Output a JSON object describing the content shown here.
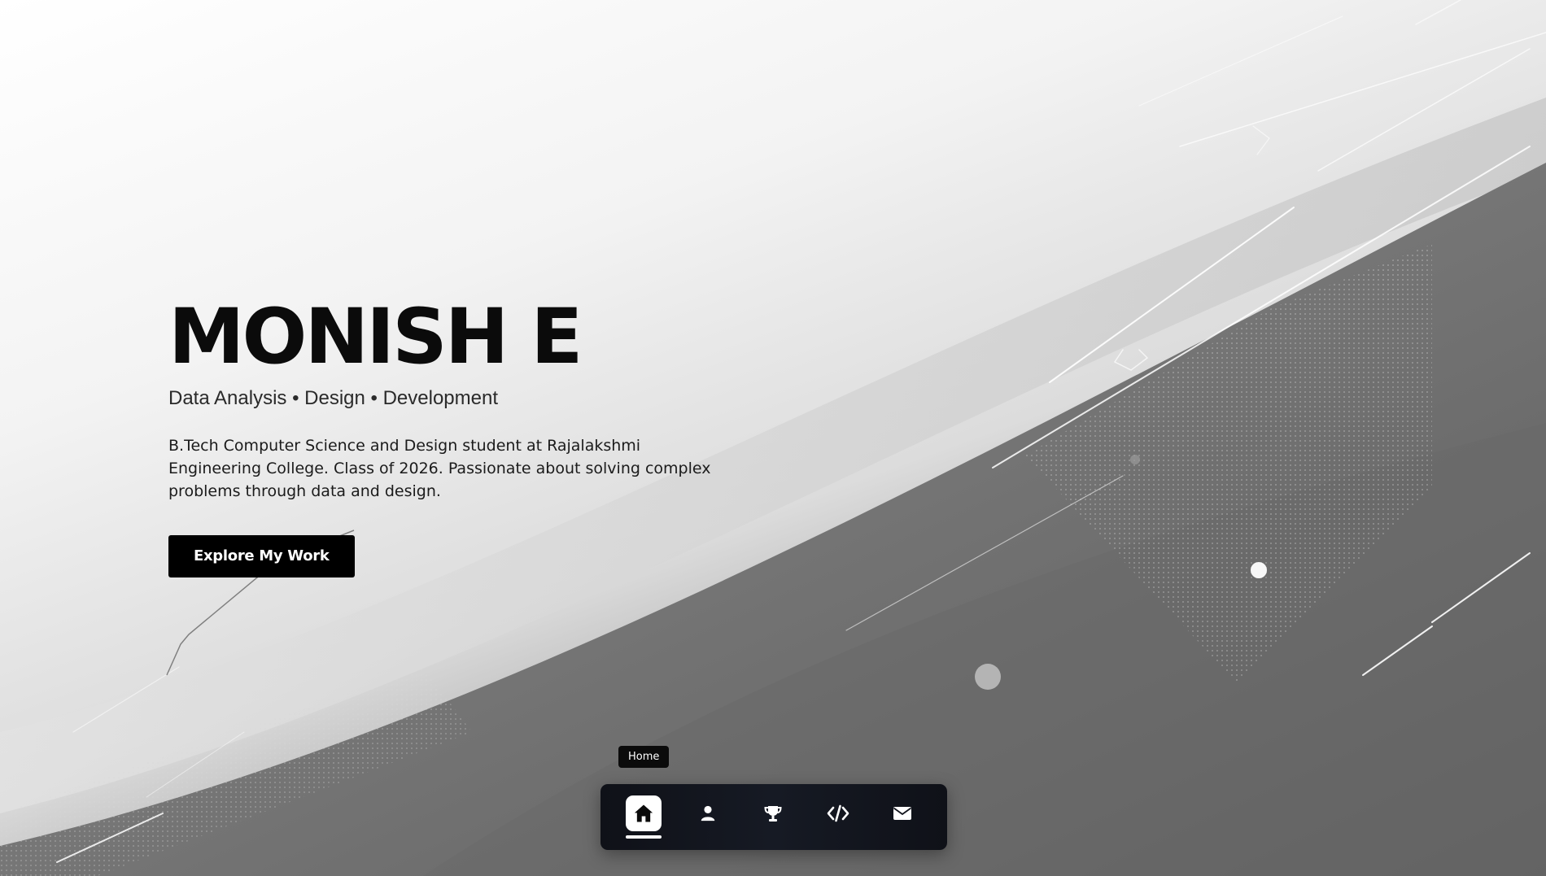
{
  "hero": {
    "name": "MONISH E",
    "tagline": "Data Analysis • Design • Development",
    "bio": "B.Tech Computer Science and Design student at Rajalakshmi Engineering College. Class of 2026. Passionate about solving complex problems through data and design.",
    "cta_label": "Explore My Work"
  },
  "nav": {
    "tooltip": "Home",
    "active": "home",
    "items": [
      {
        "key": "home",
        "icon": "home-icon"
      },
      {
        "key": "about",
        "icon": "user-icon"
      },
      {
        "key": "achievements",
        "icon": "trophy-icon"
      },
      {
        "key": "projects",
        "icon": "code-icon"
      },
      {
        "key": "contact",
        "icon": "envelope-icon"
      }
    ]
  },
  "colors": {
    "text_primary": "#0b0b0b",
    "button_bg": "#000000",
    "dock_bg": "#12151d",
    "active_item_bg": "#ffffff"
  }
}
